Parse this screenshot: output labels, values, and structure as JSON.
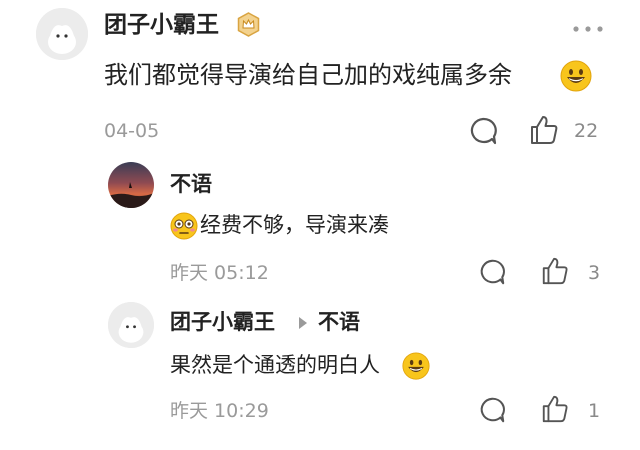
{
  "main_comment": {
    "username": "团子小霸王",
    "badge": "crown-badge-icon",
    "text": "我们都觉得导演给自己加的戏纯属多余",
    "emoji": "grinning-face-emoji",
    "date": "04-05",
    "like_count": "22",
    "more_icon": "more-dots-icon"
  },
  "replies": [
    {
      "username": "不语",
      "text": "经费不够，导演来凑",
      "emoji": "flushed-face-emoji",
      "time": "昨天 05:12",
      "like_count": "3"
    },
    {
      "username": "团子小霸王",
      "reply_to": "不语",
      "text": "果然是个通透的明白人",
      "emoji": "grinning-face-emoji",
      "time": "昨天 10:29",
      "like_count": "1"
    }
  ],
  "colors": {
    "text": "#222222",
    "meta": "#9a9a9a",
    "icon": "#555555",
    "badge": "#d9a441",
    "background": "#ffffff"
  }
}
